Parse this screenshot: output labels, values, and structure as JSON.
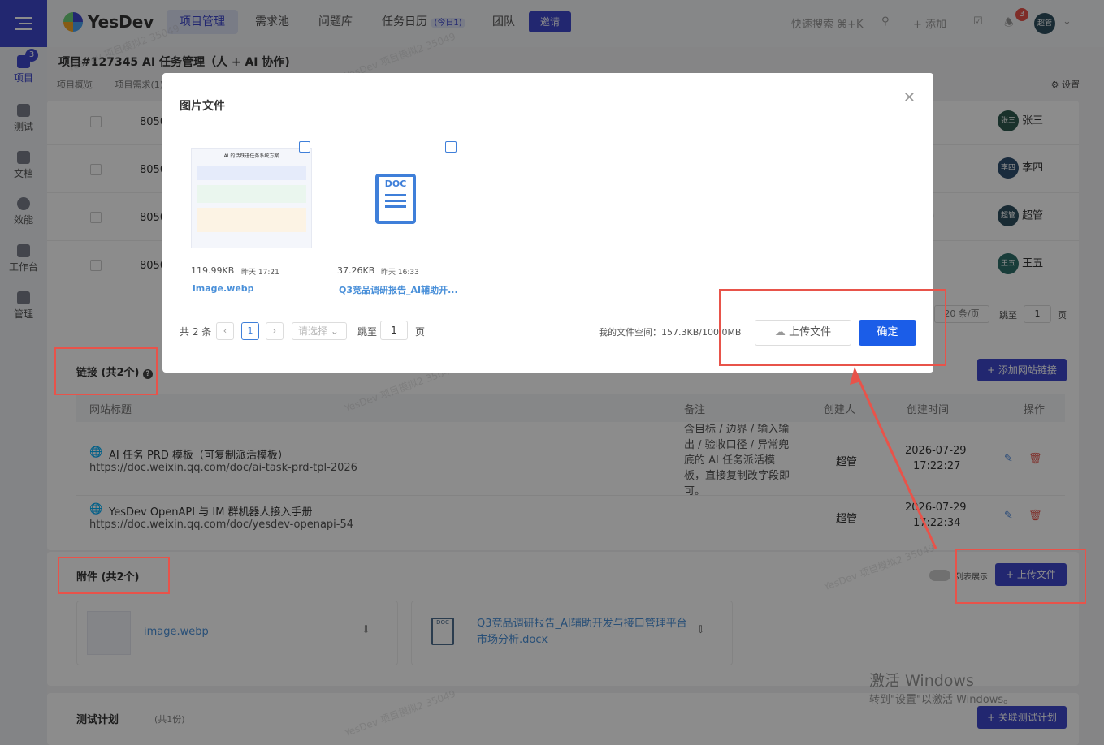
{
  "sidebar": {
    "badge": "3",
    "items": [
      {
        "label": "项目"
      },
      {
        "label": "测试"
      },
      {
        "label": "文档"
      },
      {
        "label": "效能"
      },
      {
        "label": "工作台"
      },
      {
        "label": "管理"
      }
    ]
  },
  "topbar": {
    "logo_text": "YesDev",
    "nav": [
      "项目管理",
      "需求池",
      "问题库",
      "任务日历",
      "团队"
    ],
    "calendar_badge": "(今日1)",
    "invite": "邀请",
    "search_text": "快速搜索 ⌘+K",
    "add_text": "+ 添加",
    "notif_count": "3",
    "user": "超管"
  },
  "project": {
    "title": "项目#127345 AI 任务管理（人 + AI 协作)",
    "subtabs": [
      "项目概览",
      "项目需求(1)"
    ],
    "settings": "设置"
  },
  "tasks": {
    "rows": [
      {
        "id": "8050",
        "owner_short": "张三",
        "owner": "张三"
      },
      {
        "id": "8050",
        "owner_short": "李四",
        "owner": "李四"
      },
      {
        "id": "8050",
        "owner_short": "超管",
        "owner": "超管"
      },
      {
        "id": "8050",
        "owner_short": "王五",
        "owner": "王五"
      }
    ],
    "page_size": "20 条/页",
    "jump_label": "跳至",
    "jump_value": "1",
    "page_unit": "页"
  },
  "links": {
    "title": "链接 (共2个)",
    "add_button": "+ 添加网站链接",
    "headers": [
      "网站标题",
      "备注",
      "创建人",
      "创建时间",
      "操作"
    ],
    "rows": [
      {
        "title": "AI 任务 PRD 模板（可复制派活模板）",
        "url": "https://doc.weixin.qq.com/doc/ai-task-prd-tpl-2026",
        "note": "含目标 / 边界 / 输入输出 / 验收口径 / 异常兜底的 AI 任务派活模板，直接复制改字段即可。",
        "creator": "超管",
        "date": "2026-07-29",
        "time": "17:22:27"
      },
      {
        "title": "YesDev OpenAPI 与 IM 群机器人接入手册",
        "url": "https://doc.weixin.qq.com/doc/yesdev-openapi-54",
        "note": "",
        "creator": "超管",
        "date": "2026-07-29",
        "time": "17:22:34"
      }
    ]
  },
  "attachments": {
    "title": "附件 (共2个)",
    "list_toggle": "列表展示",
    "upload_button": "+ 上传文件",
    "files": [
      {
        "name": "image.webp"
      },
      {
        "name": "Q3竞品调研报告_AI辅助开发与接口管理平台市场分析.docx"
      }
    ]
  },
  "test_plan": {
    "title": "测试计划",
    "count": "(共1份)",
    "button": "+ 关联测试计划"
  },
  "windows": {
    "line1": "激活 Windows",
    "line2": "转到\"设置\"以激活 Windows。"
  },
  "watermark_text": "YesDev 项目模拟2 35049",
  "modal": {
    "title": "图片文件",
    "preview_heading": "AI 的活跃进任务系统方案",
    "doc_label": "DOC",
    "files": [
      {
        "size": "119.99KB",
        "time": "昨天 17:21",
        "name": "image.webp"
      },
      {
        "size": "37.26KB",
        "time": "昨天 16:33",
        "name": "Q3竞品调研报告_AI辅助开..."
      }
    ],
    "total": "共 2 条",
    "page": "1",
    "select_placeholder": "请选择",
    "jump_label": "跳至",
    "jump_value": "1",
    "page_unit": "页",
    "storage": "我的文件空间：157.3KB/100.0MB",
    "upload_button": "上传文件",
    "confirm_button": "确定"
  }
}
